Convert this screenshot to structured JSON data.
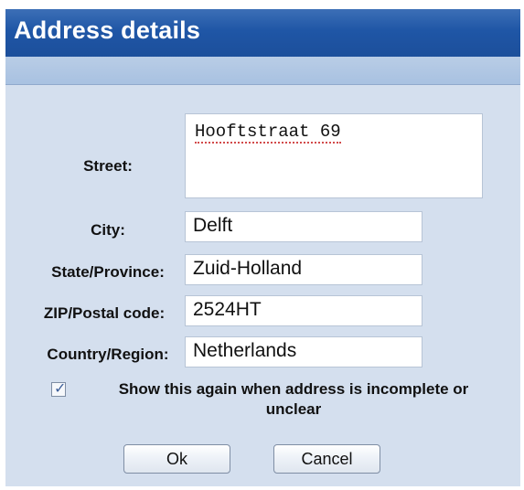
{
  "dialog": {
    "title": "Address details"
  },
  "fields": {
    "street": {
      "label": "Street:",
      "value": "Hooftstraat 69"
    },
    "city": {
      "label": "City:",
      "value": "Delft"
    },
    "state": {
      "label": "State/Province:",
      "value": "Zuid-Holland"
    },
    "zip": {
      "label": "ZIP/Postal code:",
      "value": "2524HT"
    },
    "country": {
      "label": "Country/Region:",
      "value": "Netherlands"
    }
  },
  "options": {
    "show_again": {
      "checked": true,
      "line1": "Show this again when address is incomplete or",
      "line2": "unclear"
    }
  },
  "buttons": {
    "ok": "Ok",
    "cancel": "Cancel"
  }
}
